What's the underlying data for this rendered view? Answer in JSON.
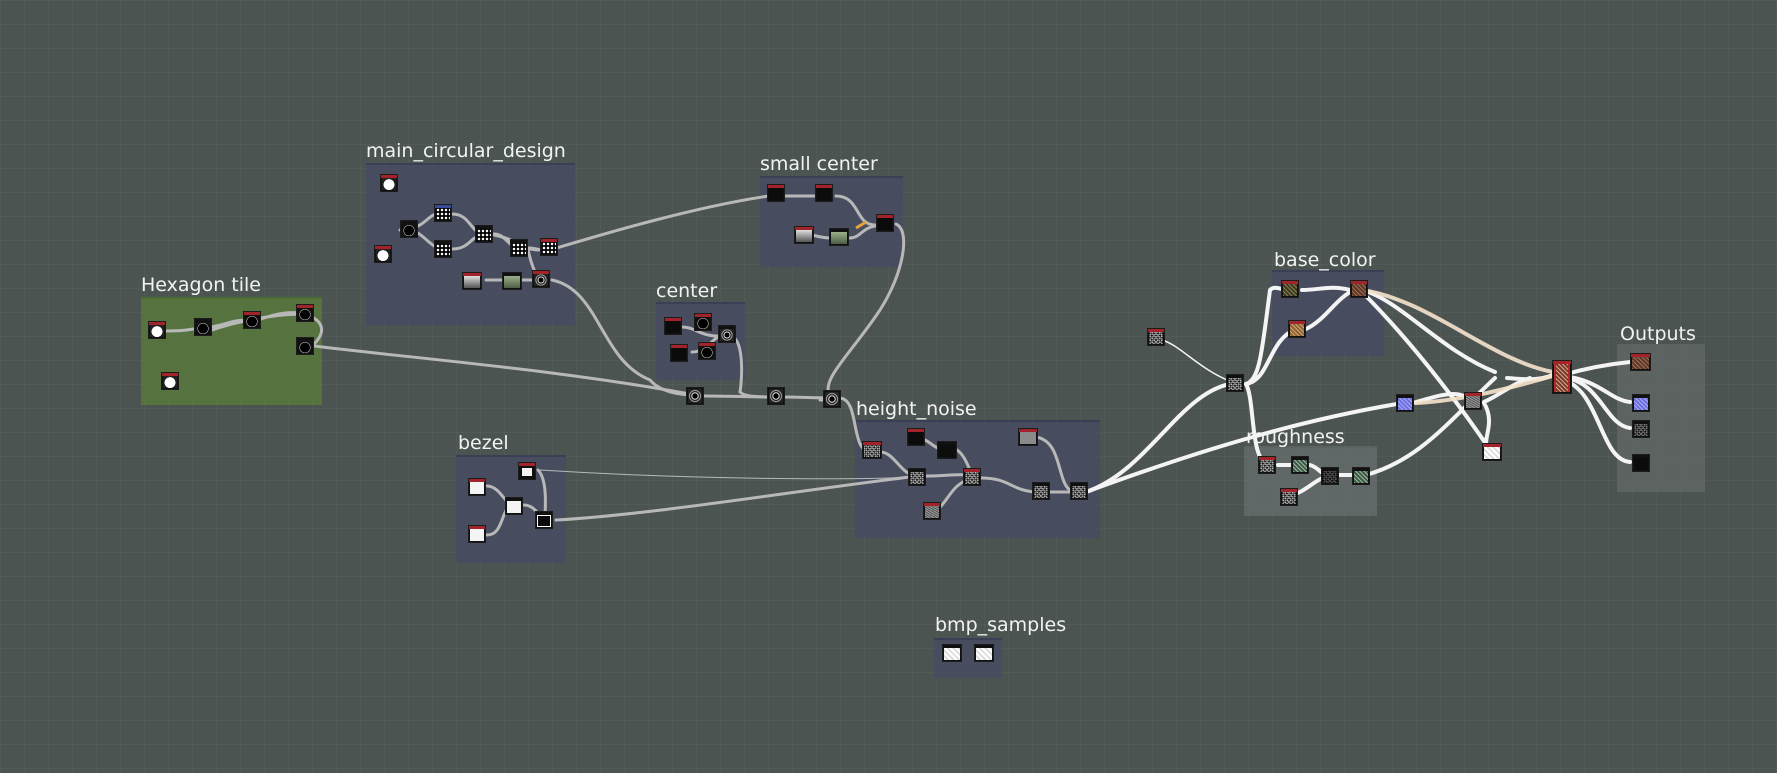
{
  "graph": {
    "frames": [
      {
        "id": "hexagon",
        "title": "Hexagon tile"
      },
      {
        "id": "main",
        "title": "main_circular_design"
      },
      {
        "id": "small",
        "title": "small center"
      },
      {
        "id": "center",
        "title": "center"
      },
      {
        "id": "bezel",
        "title": "bezel"
      },
      {
        "id": "height",
        "title": "height_noise"
      },
      {
        "id": "base",
        "title": "base_color"
      },
      {
        "id": "rough",
        "title": "roughness"
      },
      {
        "id": "outputs",
        "title": "Outputs"
      },
      {
        "id": "bmp",
        "title": "bmp_samples"
      }
    ]
  },
  "colors": {
    "canvas": "#4c5452",
    "frame_default": "#464c62",
    "frame_hexagon": "#58783c",
    "frame_outputs": "#69706e",
    "wire_gray": "#b4b4b4",
    "wire_white": "#ffffff",
    "wire_cream": "#f4e6d2",
    "node_header": "#a3232a"
  }
}
